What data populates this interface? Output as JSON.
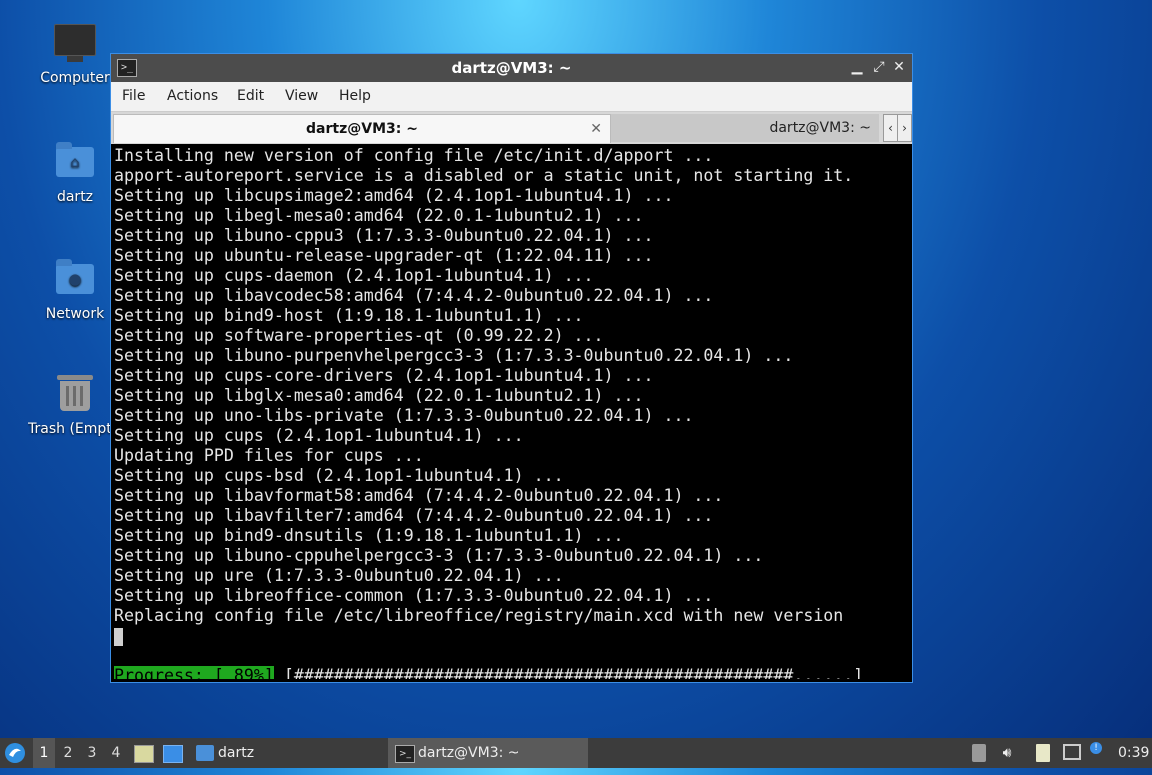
{
  "desktop": {
    "icons": [
      {
        "label": "Computer",
        "icon": "computer-icon"
      },
      {
        "label": "dartz",
        "icon": "home-folder-icon"
      },
      {
        "label": "Network",
        "icon": "network-folder-icon"
      },
      {
        "label": "Trash (Empty)",
        "icon": "trash-icon"
      }
    ]
  },
  "window": {
    "title": "dartz@VM3: ~",
    "controls": {
      "minimize": "▁",
      "maximize": "⤢",
      "close": "✕"
    },
    "menu": [
      "File",
      "Actions",
      "Edit",
      "View",
      "Help"
    ],
    "tabs": [
      {
        "label": "dartz@VM3: ~",
        "active": true,
        "close": "✕"
      },
      {
        "label": "dartz@VM3: ~",
        "active": false
      }
    ],
    "tab_scroll": {
      "left": "‹",
      "right": "›"
    }
  },
  "terminal": {
    "lines": [
      "Installing new version of config file /etc/init.d/apport ...",
      "apport-autoreport.service is a disabled or a static unit, not starting it.",
      "Setting up libcupsimage2:amd64 (2.4.1op1-1ubuntu4.1) ...",
      "Setting up libegl-mesa0:amd64 (22.0.1-1ubuntu2.1) ...",
      "Setting up libuno-cppu3 (1:7.3.3-0ubuntu0.22.04.1) ...",
      "Setting up ubuntu-release-upgrader-qt (1:22.04.11) ...",
      "Setting up cups-daemon (2.4.1op1-1ubuntu4.1) ...",
      "Setting up libavcodec58:amd64 (7:4.4.2-0ubuntu0.22.04.1) ...",
      "Setting up bind9-host (1:9.18.1-1ubuntu1.1) ...",
      "Setting up software-properties-qt (0.99.22.2) ...",
      "Setting up libuno-purpenvhelpergcc3-3 (1:7.3.3-0ubuntu0.22.04.1) ...",
      "Setting up cups-core-drivers (2.4.1op1-1ubuntu4.1) ...",
      "Setting up libglx-mesa0:amd64 (22.0.1-1ubuntu2.1) ...",
      "Setting up uno-libs-private (1:7.3.3-0ubuntu0.22.04.1) ...",
      "Setting up cups (2.4.1op1-1ubuntu4.1) ...",
      "Updating PPD files for cups ...",
      "Setting up cups-bsd (2.4.1op1-1ubuntu4.1) ...",
      "Setting up libavformat58:amd64 (7:4.4.2-0ubuntu0.22.04.1) ...",
      "Setting up libavfilter7:amd64 (7:4.4.2-0ubuntu0.22.04.1) ...",
      "Setting up bind9-dnsutils (1:9.18.1-1ubuntu1.1) ...",
      "Setting up libuno-cppuhelpergcc3-3 (1:7.3.3-0ubuntu0.22.04.1) ...",
      "Setting up ure (1:7.3.3-0ubuntu0.22.04.1) ...",
      "Setting up libreoffice-common (1:7.3.3-0ubuntu0.22.04.1) ...",
      "Replacing config file /etc/libreoffice/registry/main.xcd with new version"
    ],
    "progress": {
      "label": "Progress: [ 89%]",
      "bar": " [##################################################......]",
      "percent": 89
    }
  },
  "taskbar": {
    "start_icon": "lubuntu-start-icon",
    "workspaces": [
      "1",
      "2",
      "3",
      "4"
    ],
    "current_workspace": "1",
    "quick_launch": [
      "file-manager-icon",
      "show-desktop-icon"
    ],
    "folder_task": "dartz",
    "terminal_task": "dartz@VM3: ~",
    "tray": [
      "software-updater-icon",
      "volume-icon",
      "clipboard-icon",
      "network-icon",
      "update-notifier-icon"
    ],
    "clock": "0:39"
  }
}
